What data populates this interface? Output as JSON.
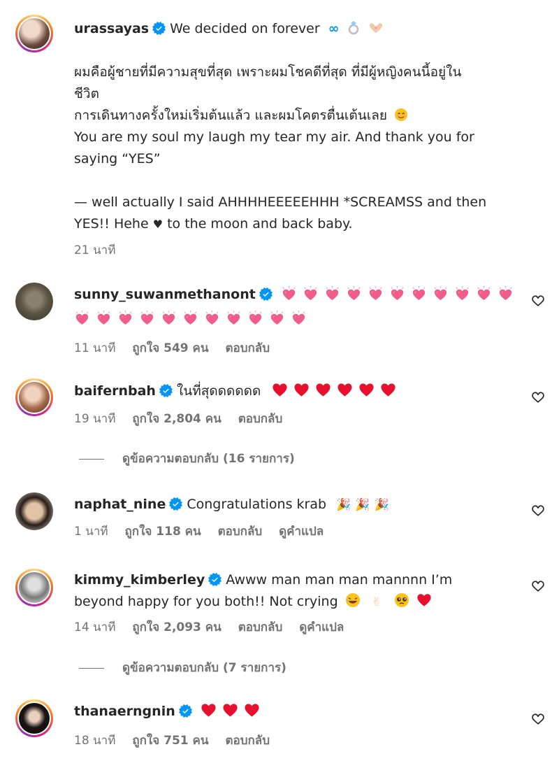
{
  "caption": {
    "username": "urassayas",
    "headline": "We decided on forever",
    "body": [
      "ผมคือผู้ชายที่มีความสุขที่สุด เพราะผมโชคดีที่สุด ที่มีผู้หญิงคนนี้อยู่ใน",
      "ชีวิต",
      "การเดินทางครั้งใหม่เริ่มต้นแล้ว และผมโคตรตื่นเต้นเลย",
      "You are my soul my laugh my tear my air. And thank you for",
      "saying “YES”",
      "— well actually I said AHHHHEEEEEHHH *SCREAMSS and then",
      "YES!! Hehe",
      "to the moon and back baby."
    ],
    "time": "21 นาที"
  },
  "labels": {
    "reply": "ตอบกลับ",
    "translate": "ดูคำแปล"
  },
  "comments": [
    {
      "username": "sunny_suwanmethanont",
      "text": "",
      "heart_emoji_line1": 11,
      "heart_emoji_line2": 11,
      "time": "11 นาที",
      "likes": "ถูกใจ 549 คน"
    },
    {
      "username": "baifernbah",
      "text": "ในที่สุดดดดดด",
      "red_hearts": 6,
      "time": "19 นาที",
      "likes": "ถูกใจ 2,804 คน",
      "view_replies": "ดูข้อความตอบกลับ (16 รายการ)"
    },
    {
      "username": "naphat_nine",
      "text": "Congratulations krab",
      "time": "1 นาที",
      "likes": "ถูกใจ 118 คน"
    },
    {
      "username": "kimmy_kimberley",
      "text_line1": "Awww man man man mannnn I’m",
      "text_line2": "beyond happy for you both!! Not crying",
      "time": "14 นาที",
      "likes": "ถูกใจ 2,093 คน",
      "view_replies": "ดูข้อความตอบกลับ (7 รายการ)"
    },
    {
      "username": "thanaerngnin",
      "text": "",
      "red_hearts": 3,
      "time": "18 นาที",
      "likes": "ถูกใจ 751 คน"
    }
  ],
  "colors": {
    "verified": "#0095f6",
    "meta": "#737373",
    "red_heart": "#e8112d",
    "pink_heart": "#f25c8a"
  }
}
